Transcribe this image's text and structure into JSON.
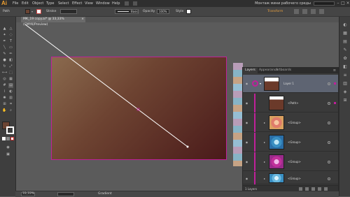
{
  "app": {
    "logo": "Ai",
    "menu": [
      "File",
      "Edit",
      "Object",
      "Type",
      "Select",
      "Effect",
      "View",
      "Window",
      "Help"
    ],
    "workspace_name": "Монтаж мини рабочего среды",
    "window_controls": [
      "–",
      "□",
      "×"
    ]
  },
  "controlbar": {
    "selection_label": "Path",
    "fill_color": "#6b4433",
    "stroke_label": "Stroke",
    "stroke_value": "",
    "brush_label": "Basic",
    "opacity_label": "Opacity",
    "opacity_value": "100%",
    "style_label": "Style",
    "transform_label": "Transform"
  },
  "document": {
    "tab_title": "МК_19 copy.ai* @ 33,33% (CMYK/Preview)",
    "close": "×"
  },
  "tools": {
    "fill_color": "#6b4433",
    "stroke_color": "#ffffff"
  },
  "layers_panel": {
    "tabs": [
      "Layers",
      "Appearance",
      "Artboards"
    ],
    "rows": [
      {
        "name": "Layer 1",
        "kind": "layer",
        "thumb": "gradient-brown",
        "selected": true
      },
      {
        "name": "<Path>",
        "kind": "path",
        "thumb": "gradient-brown"
      },
      {
        "name": "<Group>",
        "kind": "group",
        "thumb": "pattern-orange"
      },
      {
        "name": "<Group>",
        "kind": "group",
        "thumb": "pattern-blue"
      },
      {
        "name": "<Group>",
        "kind": "group",
        "thumb": "pattern-magenta"
      },
      {
        "name": "<Group>",
        "kind": "group",
        "thumb": "pattern-blue-light"
      }
    ],
    "footer_label": "1 Layers"
  },
  "status": {
    "zoom": "33,33%",
    "tool_name": "Gradient"
  },
  "colors": {
    "accent_selection": "#c0209a",
    "orange_label": "#e8a040"
  }
}
